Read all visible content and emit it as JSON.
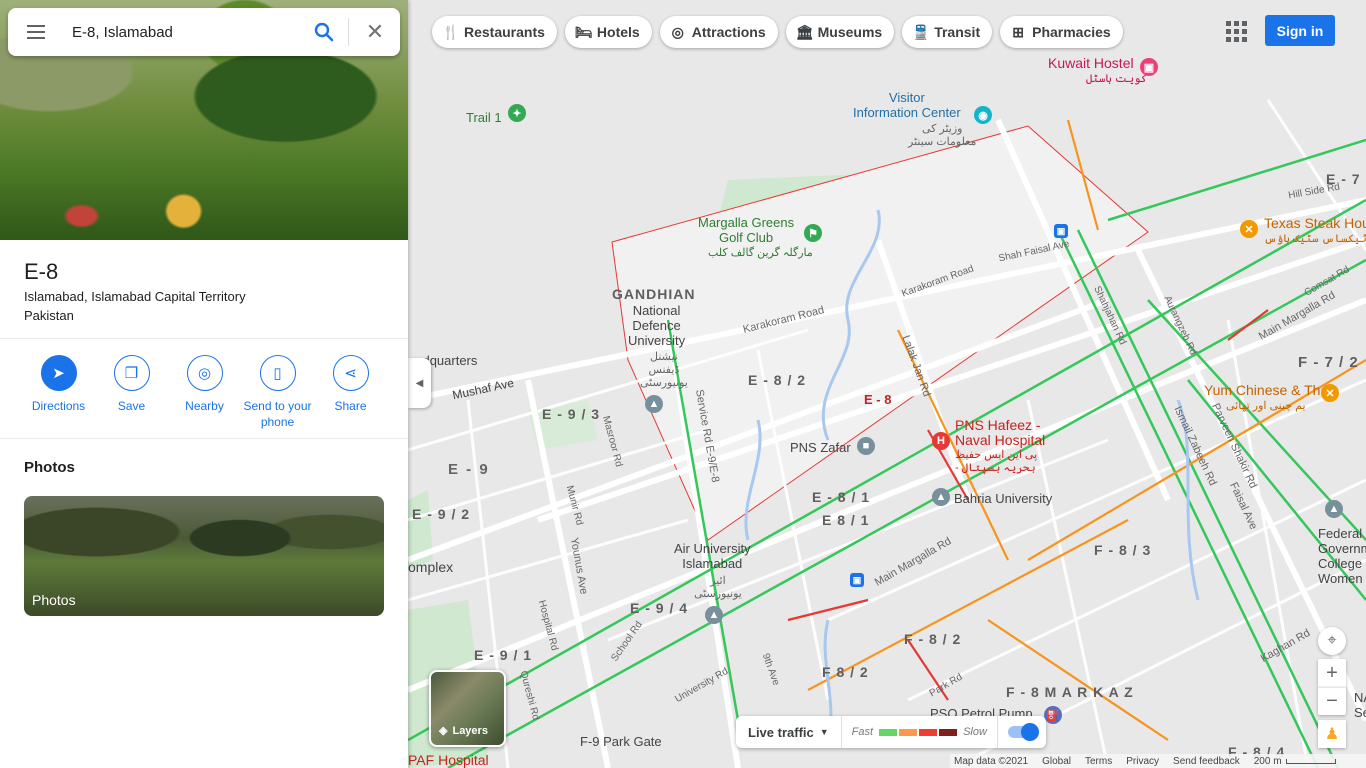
{
  "search": {
    "query": "E-8, Islamabad"
  },
  "place": {
    "title": "E-8",
    "address_line1": "Islamabad, Islamabad Capital Territory",
    "address_line2": "Pakistan"
  },
  "actions": [
    {
      "label": "Directions",
      "icon": "directions-icon"
    },
    {
      "label": "Save",
      "icon": "bookmark-icon"
    },
    {
      "label": "Nearby",
      "icon": "nearby-icon"
    },
    {
      "label": "Send to your phone",
      "icon": "phone-icon"
    },
    {
      "label": "Share",
      "icon": "share-icon"
    }
  ],
  "photos": {
    "heading": "Photos",
    "card_caption": "Photos"
  },
  "chips": [
    {
      "label": "Restaurants",
      "icon": "restaurant-icon",
      "glyph": "🍴"
    },
    {
      "label": "Hotels",
      "icon": "hotel-icon",
      "glyph": "🛏"
    },
    {
      "label": "Attractions",
      "icon": "attractions-icon",
      "glyph": "◎"
    },
    {
      "label": "Museums",
      "icon": "museum-icon",
      "glyph": "🏛"
    },
    {
      "label": "Transit",
      "icon": "transit-icon",
      "glyph": "🚆"
    },
    {
      "label": "Pharmacies",
      "icon": "pharmacy-icon",
      "glyph": "⊞"
    }
  ],
  "header": {
    "sign_in": "Sign in"
  },
  "map": {
    "labels": {
      "kuwait_hostel": "Kuwait Hostel",
      "kuwait_hostel_ur": "کویت ہاسٹل",
      "visitor_center": "Visitor\nInformation Center",
      "visitor_center_ur": "وزیٹر کی\nمعلومات سینٹر",
      "trail1": "Trail 1",
      "golf": "Margalla Greens\nGolf Club",
      "golf_ur": "مارگلہ گرین گالف کلب",
      "gandhian": "GANDHIAN",
      "ndu": "National\nDefence\nUniversity",
      "ndu_ur": "نیشنل\nڈیفنس\nیونیورسٹی",
      "headquarters": "eadquarters",
      "mushaf": "Mushaf Ave",
      "e9_3": "E - 9 / 3",
      "e9": "E - 9",
      "e9_2": "E - 9 / 2",
      "e8_2": "E - 8 / 2",
      "e8": "E - 8",
      "e8_1a": "E - 8 / 1",
      "e8_1b": "E 8 / 1",
      "pns_zafar": "PNS Zafar",
      "pns_hafeez": "PNS Hafeez -\nNaval Hospital",
      "pns_hafeez_ur": "پی این ایس حفیظ\n- بحریہ ہسپتال",
      "bahria": "Bahria University",
      "air_univ": "Air University\nIslamabad",
      "air_univ_ur": "ائیر\nیونیورسٹی",
      "e9_4": "E - 9 / 4",
      "e9_1": "E - 9 / 1",
      "complex": "omplex",
      "f9_park": "F-9 Park Gate",
      "paf": "PAF Hospital",
      "texas": "Texas Steak Hou",
      "texas_ur": "ٹیکساس سٹیک ہاؤس",
      "e7": "E - 7",
      "f7_2": "F - 7 / 2",
      "yum": "Yum Chinese & Thai",
      "yum_ur": "یم چینی اور تھائی",
      "federal": "Federal\nGovernmer\nCollege fo\nWomen F-7",
      "f8_3": "F - 8 / 3",
      "f8_2": "F - 8 / 2",
      "f8_2b": "F 8 / 2",
      "f8_markaz": "F - 8  M A R K A Z",
      "pso": "PSO Petrol Pump",
      "f8_4": "F - 8 / 4",
      "nas": "NA\nSe",
      "karakoram_rd": "Karakoram Road",
      "karakoram_rd2": "Karakoram Road",
      "lalak_jan": "Lalak Jan Rd",
      "shah_faisal": "Shah Faisal Ave",
      "main_margalla": "Main Margalla Rd",
      "main_margalla2": "Main Margalla Rd",
      "service_rd": "Service Rd E-9/E-8",
      "younus": "Younus Ave",
      "parveen": "Parveen Shakir Rd",
      "faisal_ave": "Faisal Ave",
      "ismail": "Ismail Zabeeh Rd",
      "kaghan": "Kaghan Rd",
      "park_rd": "Park Rd",
      "ninth_ave": "9th Ave",
      "hill_side": "Hill Side Rd",
      "comsat": "Comsat Rd",
      "aurangzeb": "Aurangzeb Rd",
      "shahjahan": "Shahjahan Rd",
      "masroor": "Masroor Rd",
      "munir": "Munir Rd",
      "hospital_rd": "Hospital Rd",
      "school_rd": "School Rd",
      "university_rd": "University Rd",
      "qureshi": "Qureshi Rd"
    }
  },
  "map_controls": {
    "layers_label": "Layers",
    "live_traffic": "Live traffic",
    "fast": "Fast",
    "slow": "Slow",
    "traffic_colors": [
      "#63d668",
      "#ff974d",
      "#f23c32",
      "#811f1f"
    ]
  },
  "footer": {
    "map_data": "Map data ©2021",
    "global": "Global",
    "terms": "Terms",
    "privacy": "Privacy",
    "feedback": "Send feedback",
    "scale": "200 m"
  }
}
